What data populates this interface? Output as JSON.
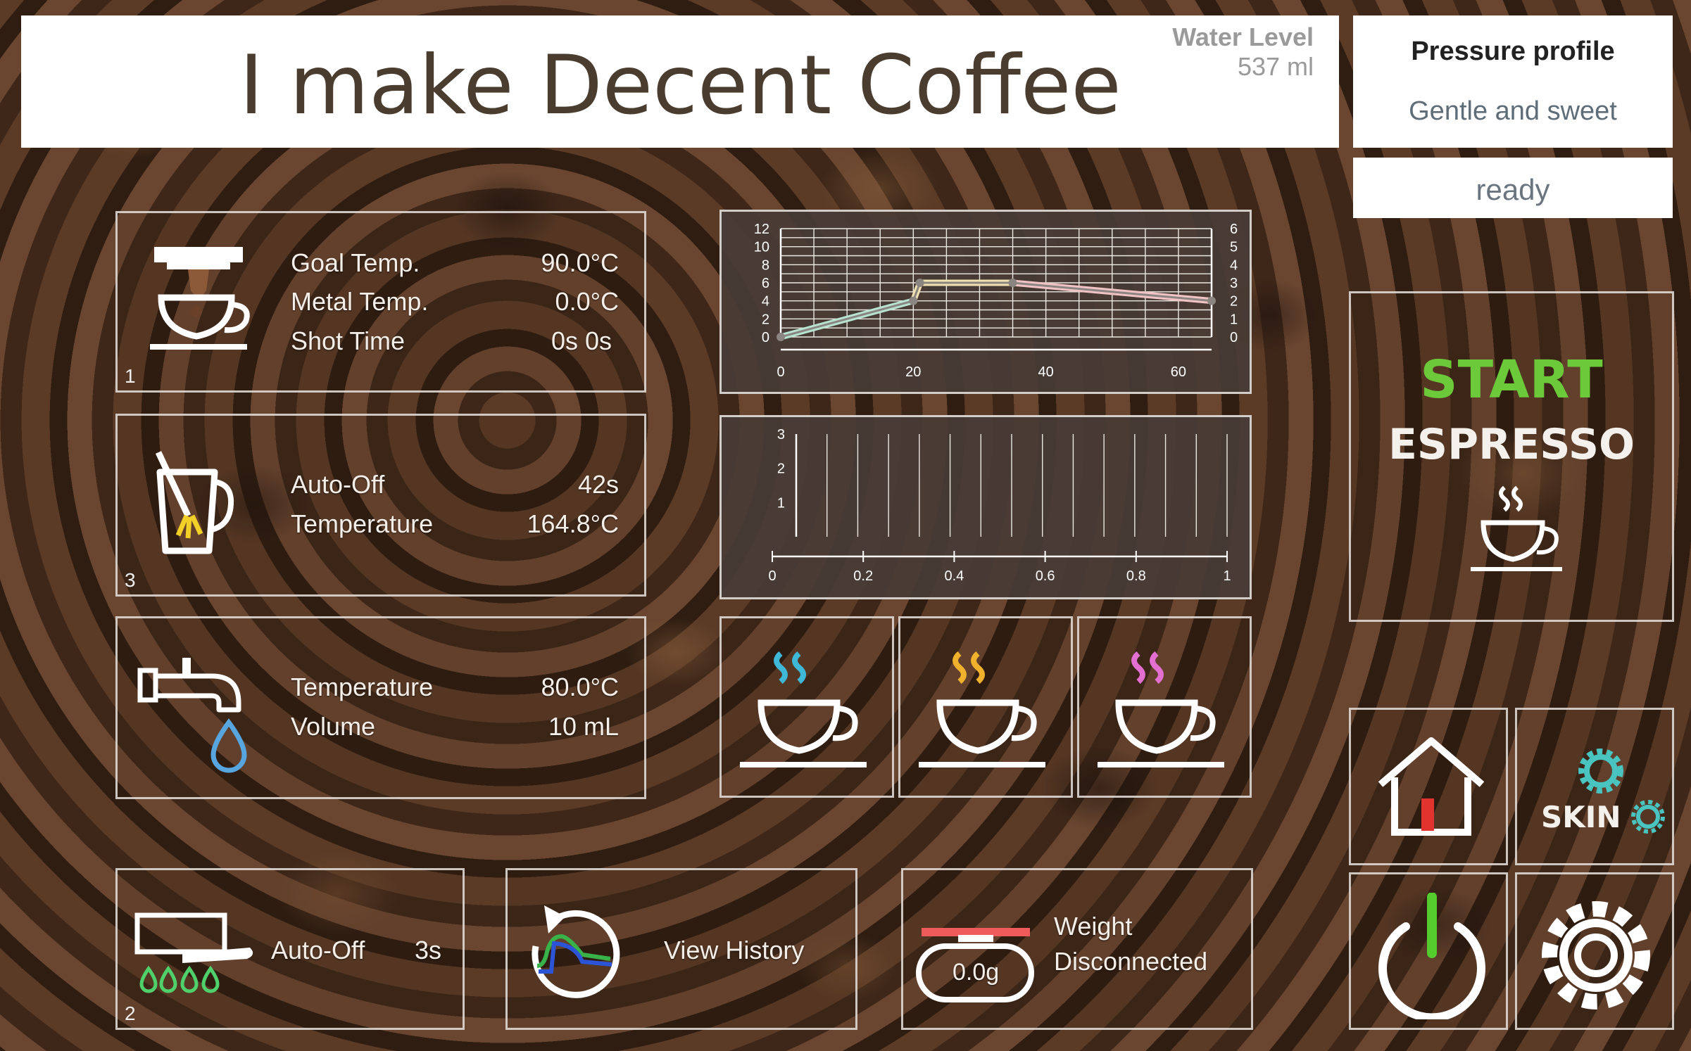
{
  "header": {
    "title": "I make Decent Coffee",
    "water_level_label": "Water Level",
    "water_level_value": "537 ml"
  },
  "profile": {
    "heading": "Pressure profile",
    "name": "Gentle and sweet"
  },
  "status": {
    "text": "ready"
  },
  "espresso_panel": {
    "index": "1",
    "goal_label": "Goal Temp.",
    "goal_value": "90.0°C",
    "metal_label": "Metal Temp.",
    "metal_value": "0.0°C",
    "shot_label": "Shot Time",
    "shot_value": "0s  0s"
  },
  "steam_panel": {
    "index": "3",
    "autooff_label": "Auto-Off",
    "autooff_value": "42s",
    "temp_label": "Temperature",
    "temp_value": "164.8°C"
  },
  "water_panel": {
    "temp_label": "Temperature",
    "temp_value": "80.0°C",
    "volume_label": "Volume",
    "volume_value": "10 mL"
  },
  "flush_panel": {
    "index": "2",
    "autooff_label": "Auto-Off",
    "autooff_value": "3s"
  },
  "history": {
    "label": "View History"
  },
  "scale": {
    "weight_label": "Weight",
    "status": "Disconnected",
    "reading": "0.0g"
  },
  "start": {
    "start_label": "START",
    "mode_label": "ESPRESSO"
  },
  "skin": {
    "label": "SKIN"
  },
  "colors": {
    "start_green": "#6cc93a",
    "steam_blue": "#3fb8d8",
    "steam_yellow": "#f0b12c",
    "steam_pink": "#e36fd0",
    "power_green": "#55cc2e",
    "scale_red": "#ef5b5b",
    "skin_teal": "#49c4c0"
  },
  "icons": [
    "espresso-machine-icon",
    "steam-pitcher-icon",
    "water-tap-icon",
    "flush-icon",
    "history-icon",
    "scale-icon",
    "espresso-cup-icon",
    "home-icon",
    "skin-gear-icon",
    "power-icon",
    "settings-gear-icon"
  ],
  "chart_data": [
    {
      "type": "line",
      "x_ticks": [
        "0",
        "20",
        "40",
        "60"
      ],
      "y_left_ticks": [
        "0",
        "2",
        "4",
        "6",
        "8",
        "10",
        "12"
      ],
      "y_right_ticks": [
        "0",
        "1",
        "2",
        "3",
        "4",
        "5",
        "6"
      ],
      "xlim": [
        0,
        65
      ],
      "ylim_left": [
        0,
        12
      ],
      "ylim_right": [
        0,
        6
      ],
      "grid": true,
      "series": [
        {
          "x": [
            0,
            20
          ],
          "y": [
            0,
            4
          ],
          "color": "#b7e3d1"
        },
        {
          "x": [
            20,
            21,
            35
          ],
          "y": [
            4,
            6,
            6
          ],
          "color": "#efe1b0"
        },
        {
          "x": [
            35,
            65
          ],
          "y": [
            6,
            4
          ],
          "color": "#f1c3c4"
        }
      ]
    },
    {
      "type": "line",
      "x_ticks": [
        "0",
        "0.2",
        "0.4",
        "0.6",
        "0.8",
        "1"
      ],
      "y_ticks": [
        "1",
        "2",
        "3"
      ],
      "xlim": [
        0,
        1
      ],
      "ylim": [
        0,
        3
      ],
      "grid": true,
      "series": []
    }
  ]
}
